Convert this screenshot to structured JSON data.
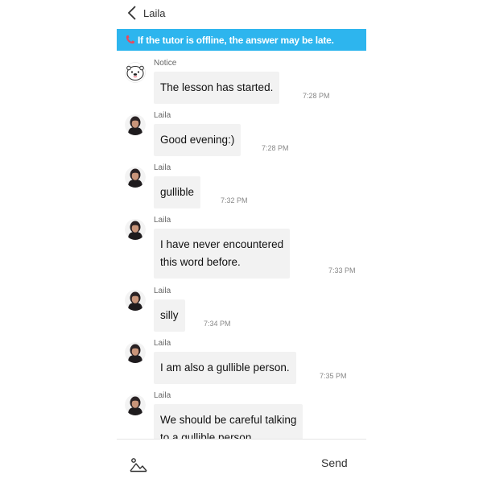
{
  "header": {
    "title": "Laila",
    "back_icon": "chevron-left-icon"
  },
  "banner": {
    "icon": "phone-icon",
    "text": "If the tutor is offline, the answer may be late.",
    "color": "#2db5ee"
  },
  "messages": [
    {
      "sender": "Notice",
      "avatar": "otter-mascot-icon",
      "text": "The lesson has started.",
      "time": "7:28 PM"
    },
    {
      "sender": "Laila",
      "avatar": "tutor-photo",
      "text": "Good evening:)",
      "time": "7:28 PM"
    },
    {
      "sender": "Laila",
      "avatar": "tutor-photo",
      "text": "gullible",
      "time": "7:32 PM"
    },
    {
      "sender": "Laila",
      "avatar": "tutor-photo",
      "line1": "I have never encountered",
      "line2": "this word before.",
      "time": "7:33 PM"
    },
    {
      "sender": "Laila",
      "avatar": "tutor-photo",
      "text": "silly",
      "time": "7:34 PM"
    },
    {
      "sender": "Laila",
      "avatar": "tutor-photo",
      "text": "I am also a gullible person.",
      "time": "7:35 PM"
    },
    {
      "sender": "Laila",
      "avatar": "tutor-photo",
      "line1": "We should be careful talking",
      "line2": "to a gullible person."
    }
  ],
  "composer": {
    "image_icon": "image-icon",
    "send_label": "Send"
  }
}
